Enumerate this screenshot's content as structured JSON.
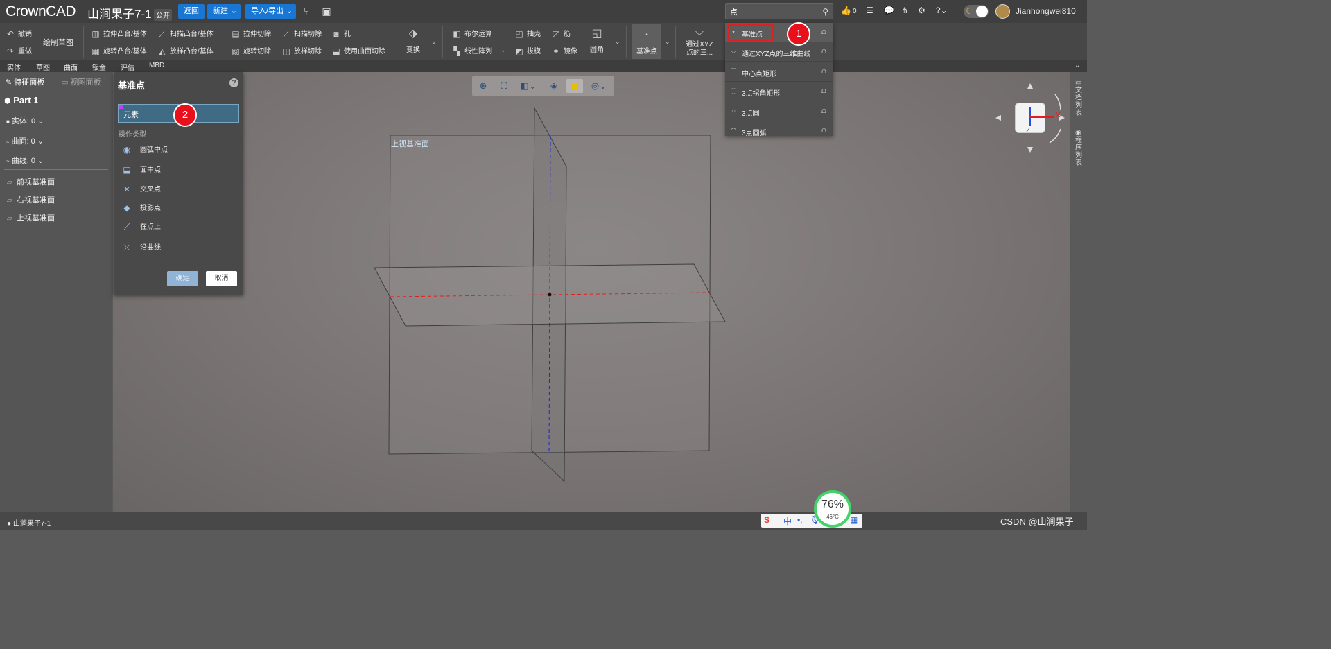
{
  "app": {
    "logo": "CrownCAD",
    "doc_title": "山涧果子7-1",
    "visibility": "公开"
  },
  "topbar": {
    "back": "返回",
    "new": "新建",
    "import_export": "导入/导出",
    "search_value": "点",
    "likes": "0",
    "user": "Jianhongwei810"
  },
  "ribbon": {
    "undo": "撤销",
    "redo": "重做",
    "sketch": "绘制草图",
    "extrude_boss": "拉伸凸台/基体",
    "sweep_boss": "扫描凸台/基体",
    "revolve_boss": "旋转凸台/基体",
    "loft_boss": "放样凸台/基体",
    "extrude_cut": "拉伸切除",
    "sweep_cut": "扫描切除",
    "hole": "孔",
    "revolve_cut": "旋转切除",
    "loft_cut": "放样切除",
    "surface_cut": "使用曲面切除",
    "transform": "变换",
    "boolean": "布尔运算",
    "linear_pattern": "线性阵列",
    "shell": "抽壳",
    "rib": "筋",
    "draft": "拔模",
    "mirror": "镜像",
    "fillet": "圆角",
    "datum_point": "基准点",
    "xyz_curve_line1": "通过XYZ",
    "xyz_curve_line2": "点的三..."
  },
  "modtabs": [
    "实体",
    "草图",
    "曲面",
    "钣金",
    "评估",
    "MBD"
  ],
  "leftpanel": {
    "tab_feature": "特征面板",
    "tab_view": "视图面板",
    "part": "Part 1",
    "solid": "实体: 0",
    "surface": "曲面: 0",
    "curve": "曲线: 0",
    "planes": [
      "前视基准面",
      "右视基准面",
      "上视基准面"
    ]
  },
  "dialog": {
    "title": "基准点",
    "field": "元素",
    "section": "操作类型",
    "ops": [
      "圆弧中点",
      "面中点",
      "交叉点",
      "投影点",
      "在点上",
      "沿曲线"
    ],
    "ok": "确定",
    "cancel": "取消"
  },
  "viewport": {
    "plane_label": "上视基准面"
  },
  "dropdown": [
    {
      "label": "基准点",
      "icon": "dot-icon"
    },
    {
      "label": "通过XYZ点的三维曲线",
      "icon": "curve-icon"
    },
    {
      "label": "中心点矩形",
      "icon": "rect-icon"
    },
    {
      "label": "3点拐角矩形",
      "icon": "rect3-icon"
    },
    {
      "label": "3点圆",
      "icon": "circle-icon"
    },
    {
      "label": "3点圆弧",
      "icon": "arc-icon"
    }
  ],
  "rightstrip": {
    "doc_list": "文档列表",
    "program_list": "程序列表"
  },
  "annotations": {
    "badge1": "1",
    "badge2": "2"
  },
  "status": {
    "doc": "山涧果子7-1",
    "perf_value": "76%",
    "perf_temp": "46°C",
    "watermark": "CSDN @山涧果子"
  },
  "colors": {
    "accent": "#1976d2",
    "annotation": "#e8101a",
    "x_axis": "#e02020",
    "z_axis": "#2020e0"
  }
}
